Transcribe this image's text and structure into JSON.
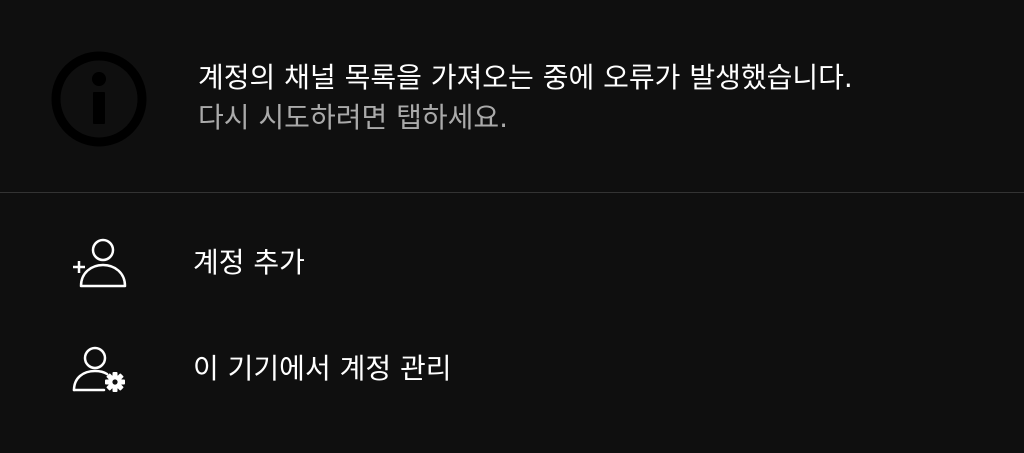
{
  "error": {
    "title": "계정의 채널 목록을 가져오는 중에 오류가 발생했습니다.",
    "subtitle": "다시 시도하려면 탭하세요.",
    "icon": "info-icon"
  },
  "menu": [
    {
      "label": "계정 추가",
      "icon": "add-account-icon"
    },
    {
      "label": "이 기기에서 계정 관리",
      "icon": "manage-accounts-icon"
    }
  ],
  "colors": {
    "background": "#0f0f0f",
    "text_primary": "#ffffff",
    "text_secondary": "#aaaaaa",
    "divider": "#333333",
    "info_icon": "#000000"
  }
}
